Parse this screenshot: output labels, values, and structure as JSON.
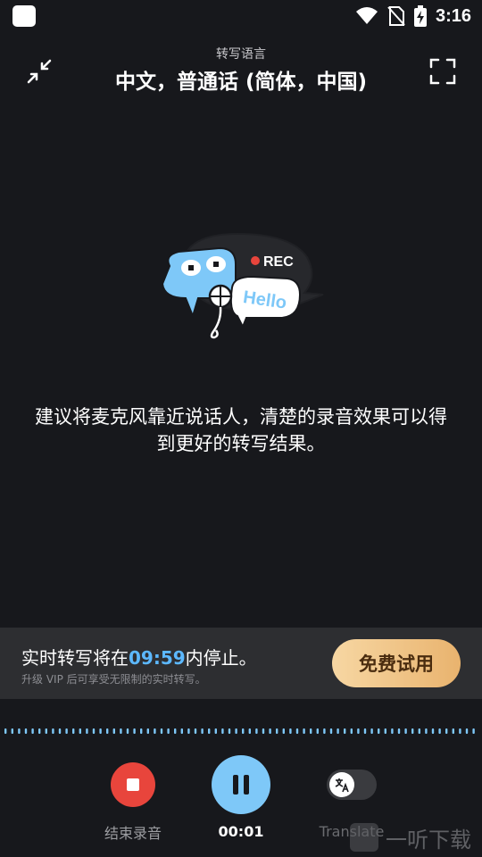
{
  "status_bar": {
    "time": "3:16",
    "icons": [
      "app-icon",
      "wifi-icon",
      "no-sim-icon",
      "battery-charging-icon"
    ]
  },
  "header": {
    "subtitle": "转写语言",
    "title": "中文，普通话 (简体，中国)",
    "left_icon": "collapse-icon",
    "right_icon": "fullscreen-icon"
  },
  "illustration": {
    "rec_label": "REC",
    "hello_label": "Hello"
  },
  "hint": "建议将麦克风靠近说话人，清楚的录音效果可以得到更好的转写结果。",
  "banner": {
    "main_prefix": "实时转写将在",
    "timer": "09:59",
    "main_suffix": "内停止。",
    "sub": "升级 VIP 后可享受无限制的实时转写。",
    "trial_button": "免费试用"
  },
  "controls": {
    "stop_label": "结束录音",
    "elapsed": "00:01",
    "translate_label": "Translate",
    "translate_on": false
  },
  "watermark": {
    "text": "一听下载"
  },
  "colors": {
    "background": "#17181c",
    "accent_blue": "#7ec8f8",
    "timer_blue": "#5cb8ff",
    "stop_red": "#e8453c",
    "trial_gold": "#e9b36e"
  }
}
